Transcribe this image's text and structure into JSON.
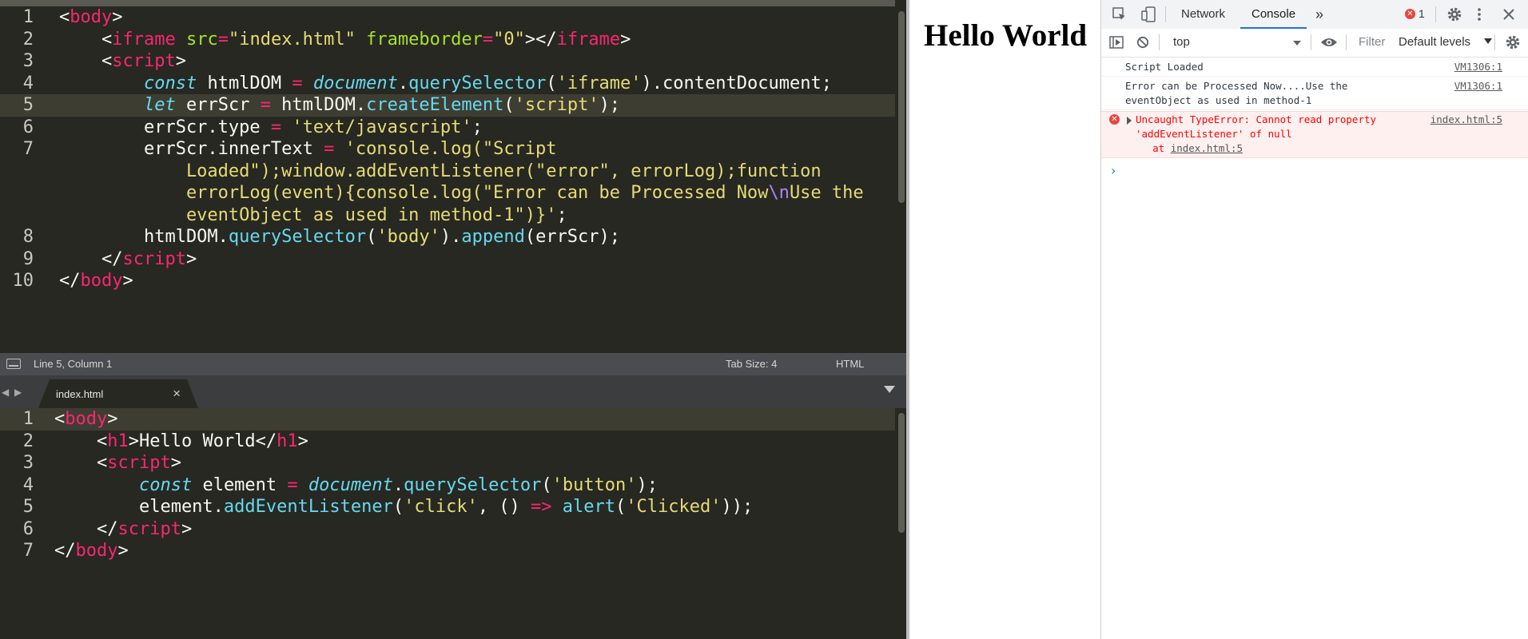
{
  "editor": {
    "top_pane": {
      "lines": [
        {
          "num": "1",
          "tokens": [
            [
              "p",
              "<"
            ],
            [
              "t",
              "body"
            ],
            [
              "p",
              ">"
            ]
          ]
        },
        {
          "num": "2",
          "tokens": [
            [
              "p",
              "    <"
            ],
            [
              "t",
              "iframe"
            ],
            [
              "p",
              " "
            ],
            [
              "a",
              "src"
            ],
            [
              "t",
              "="
            ],
            [
              "s",
              "\"index.html\""
            ],
            [
              "p",
              " "
            ],
            [
              "a",
              "frameborder"
            ],
            [
              "t",
              "="
            ],
            [
              "s",
              "\"0\""
            ],
            [
              "p",
              "></"
            ],
            [
              "t",
              "iframe"
            ],
            [
              "p",
              ">"
            ]
          ]
        },
        {
          "num": "3",
          "tokens": [
            [
              "p",
              "    <"
            ],
            [
              "t",
              "script"
            ],
            [
              "p",
              ">"
            ]
          ]
        },
        {
          "num": "4",
          "tokens": [
            [
              "p",
              "        "
            ],
            [
              "k",
              "const"
            ],
            [
              "p",
              " htmlDOM "
            ],
            [
              "t",
              "="
            ],
            [
              "p",
              " "
            ],
            [
              "k",
              "document"
            ],
            [
              "p",
              "."
            ],
            [
              "f",
              "querySelector"
            ],
            [
              "p",
              "("
            ],
            [
              "s",
              "'iframe'"
            ],
            [
              "p",
              ").contentDocument;"
            ]
          ]
        },
        {
          "num": "5",
          "current": true,
          "tokens": [
            [
              "p",
              "        "
            ],
            [
              "k",
              "let"
            ],
            [
              "p",
              " errScr "
            ],
            [
              "t",
              "="
            ],
            [
              "p",
              " htmlDOM."
            ],
            [
              "f",
              "createElement"
            ],
            [
              "p",
              "("
            ],
            [
              "s",
              "'script'"
            ],
            [
              "p",
              ");"
            ]
          ]
        },
        {
          "num": "6",
          "tokens": [
            [
              "p",
              "        errScr.type "
            ],
            [
              "t",
              "="
            ],
            [
              "p",
              " "
            ],
            [
              "s",
              "'text/javascript'"
            ],
            [
              "p",
              ";"
            ]
          ]
        },
        {
          "num": "7",
          "tokens": [
            [
              "p",
              "        errScr.innerText "
            ],
            [
              "t",
              "="
            ],
            [
              "p",
              " "
            ],
            [
              "s",
              "'console.log(\"Script"
            ]
          ]
        },
        {
          "num": "",
          "tokens": [
            [
              "s",
              "            Loaded\");window.addEventListener(\"error\", errorLog);function"
            ]
          ]
        },
        {
          "num": "",
          "tokens": [
            [
              "s",
              "            errorLog(event){console.log(\"Error can be Processed Now"
            ],
            [
              "e",
              "\\n"
            ],
            [
              "s",
              "Use the"
            ]
          ]
        },
        {
          "num": "",
          "tokens": [
            [
              "s",
              "            eventObject as used in method-1\")}'"
            ],
            [
              "p",
              ";"
            ]
          ]
        },
        {
          "num": "8",
          "tokens": [
            [
              "p",
              "        htmlDOM."
            ],
            [
              "f",
              "querySelector"
            ],
            [
              "p",
              "("
            ],
            [
              "s",
              "'body'"
            ],
            [
              "p",
              ")."
            ],
            [
              "f",
              "append"
            ],
            [
              "p",
              "(errScr);"
            ]
          ]
        },
        {
          "num": "9",
          "tokens": [
            [
              "p",
              "    </"
            ],
            [
              "t",
              "script"
            ],
            [
              "p",
              ">"
            ]
          ]
        },
        {
          "num": "10",
          "tokens": [
            [
              "p",
              "</"
            ],
            [
              "t",
              "body"
            ],
            [
              "p",
              ">"
            ]
          ]
        }
      ]
    },
    "status": {
      "position": "Line 5, Column 1",
      "tab_size": "Tab Size: 4",
      "syntax": "HTML"
    },
    "tab": {
      "filename": "index.html",
      "close": "×",
      "nav_left": "◀",
      "nav_right": "▶"
    },
    "bottom_pane": {
      "lines": [
        {
          "num": "1",
          "current": true,
          "tokens": [
            [
              "p",
              "<"
            ],
            [
              "t",
              "body"
            ],
            [
              "p",
              ">"
            ]
          ]
        },
        {
          "num": "2",
          "tokens": [
            [
              "p",
              "    <"
            ],
            [
              "t",
              "h1"
            ],
            [
              "p",
              ">Hello World</"
            ],
            [
              "t",
              "h1"
            ],
            [
              "p",
              ">"
            ]
          ]
        },
        {
          "num": "3",
          "tokens": [
            [
              "p",
              "    <"
            ],
            [
              "t",
              "script"
            ],
            [
              "p",
              ">"
            ]
          ]
        },
        {
          "num": "4",
          "tokens": [
            [
              "p",
              "        "
            ],
            [
              "k",
              "const"
            ],
            [
              "p",
              " element "
            ],
            [
              "t",
              "="
            ],
            [
              "p",
              " "
            ],
            [
              "k",
              "document"
            ],
            [
              "p",
              "."
            ],
            [
              "f",
              "querySelector"
            ],
            [
              "p",
              "("
            ],
            [
              "s",
              "'button'"
            ],
            [
              "p",
              ");"
            ]
          ]
        },
        {
          "num": "5",
          "tokens": [
            [
              "p",
              "        element."
            ],
            [
              "f",
              "addEventListener"
            ],
            [
              "p",
              "("
            ],
            [
              "s",
              "'click'"
            ],
            [
              "p",
              ", () "
            ],
            [
              "t",
              "=>"
            ],
            [
              "p",
              " "
            ],
            [
              "f",
              "alert"
            ],
            [
              "p",
              "("
            ],
            [
              "s",
              "'Clicked'"
            ],
            [
              "p",
              "));"
            ]
          ]
        },
        {
          "num": "6",
          "tokens": [
            [
              "p",
              "    </"
            ],
            [
              "t",
              "script"
            ],
            [
              "p",
              ">"
            ]
          ]
        },
        {
          "num": "7",
          "tokens": [
            [
              "p",
              "</"
            ],
            [
              "t",
              "body"
            ],
            [
              "p",
              ">"
            ]
          ]
        }
      ]
    }
  },
  "viewport": {
    "heading": "Hello World"
  },
  "devtools": {
    "tabs": {
      "network": "Network",
      "console": "Console",
      "more": "»"
    },
    "error_count": "1",
    "toolbar": {
      "context": "top",
      "filter_placeholder": "Filter",
      "levels": "Default levels"
    },
    "messages": [
      {
        "text": "Script Loaded",
        "source": "VM1306:1"
      },
      {
        "text": "Error can be Processed Now....Use the\neventObject as used in method-1",
        "source": "VM1306:1"
      }
    ],
    "error": {
      "text": "Uncaught TypeError: Cannot read property\n'addEventListener' of null",
      "at_prefix": "    at ",
      "at_link": "index.html:5",
      "source": "index.html:5"
    },
    "prompt": "›"
  },
  "colors": {
    "editor_bg": "#272822",
    "tag": "#f92672",
    "string": "#e6db74",
    "attr": "#a6e22e",
    "func": "#66d9ef",
    "error_text": "#ff0000",
    "devtools_accent": "#1a73e8"
  }
}
